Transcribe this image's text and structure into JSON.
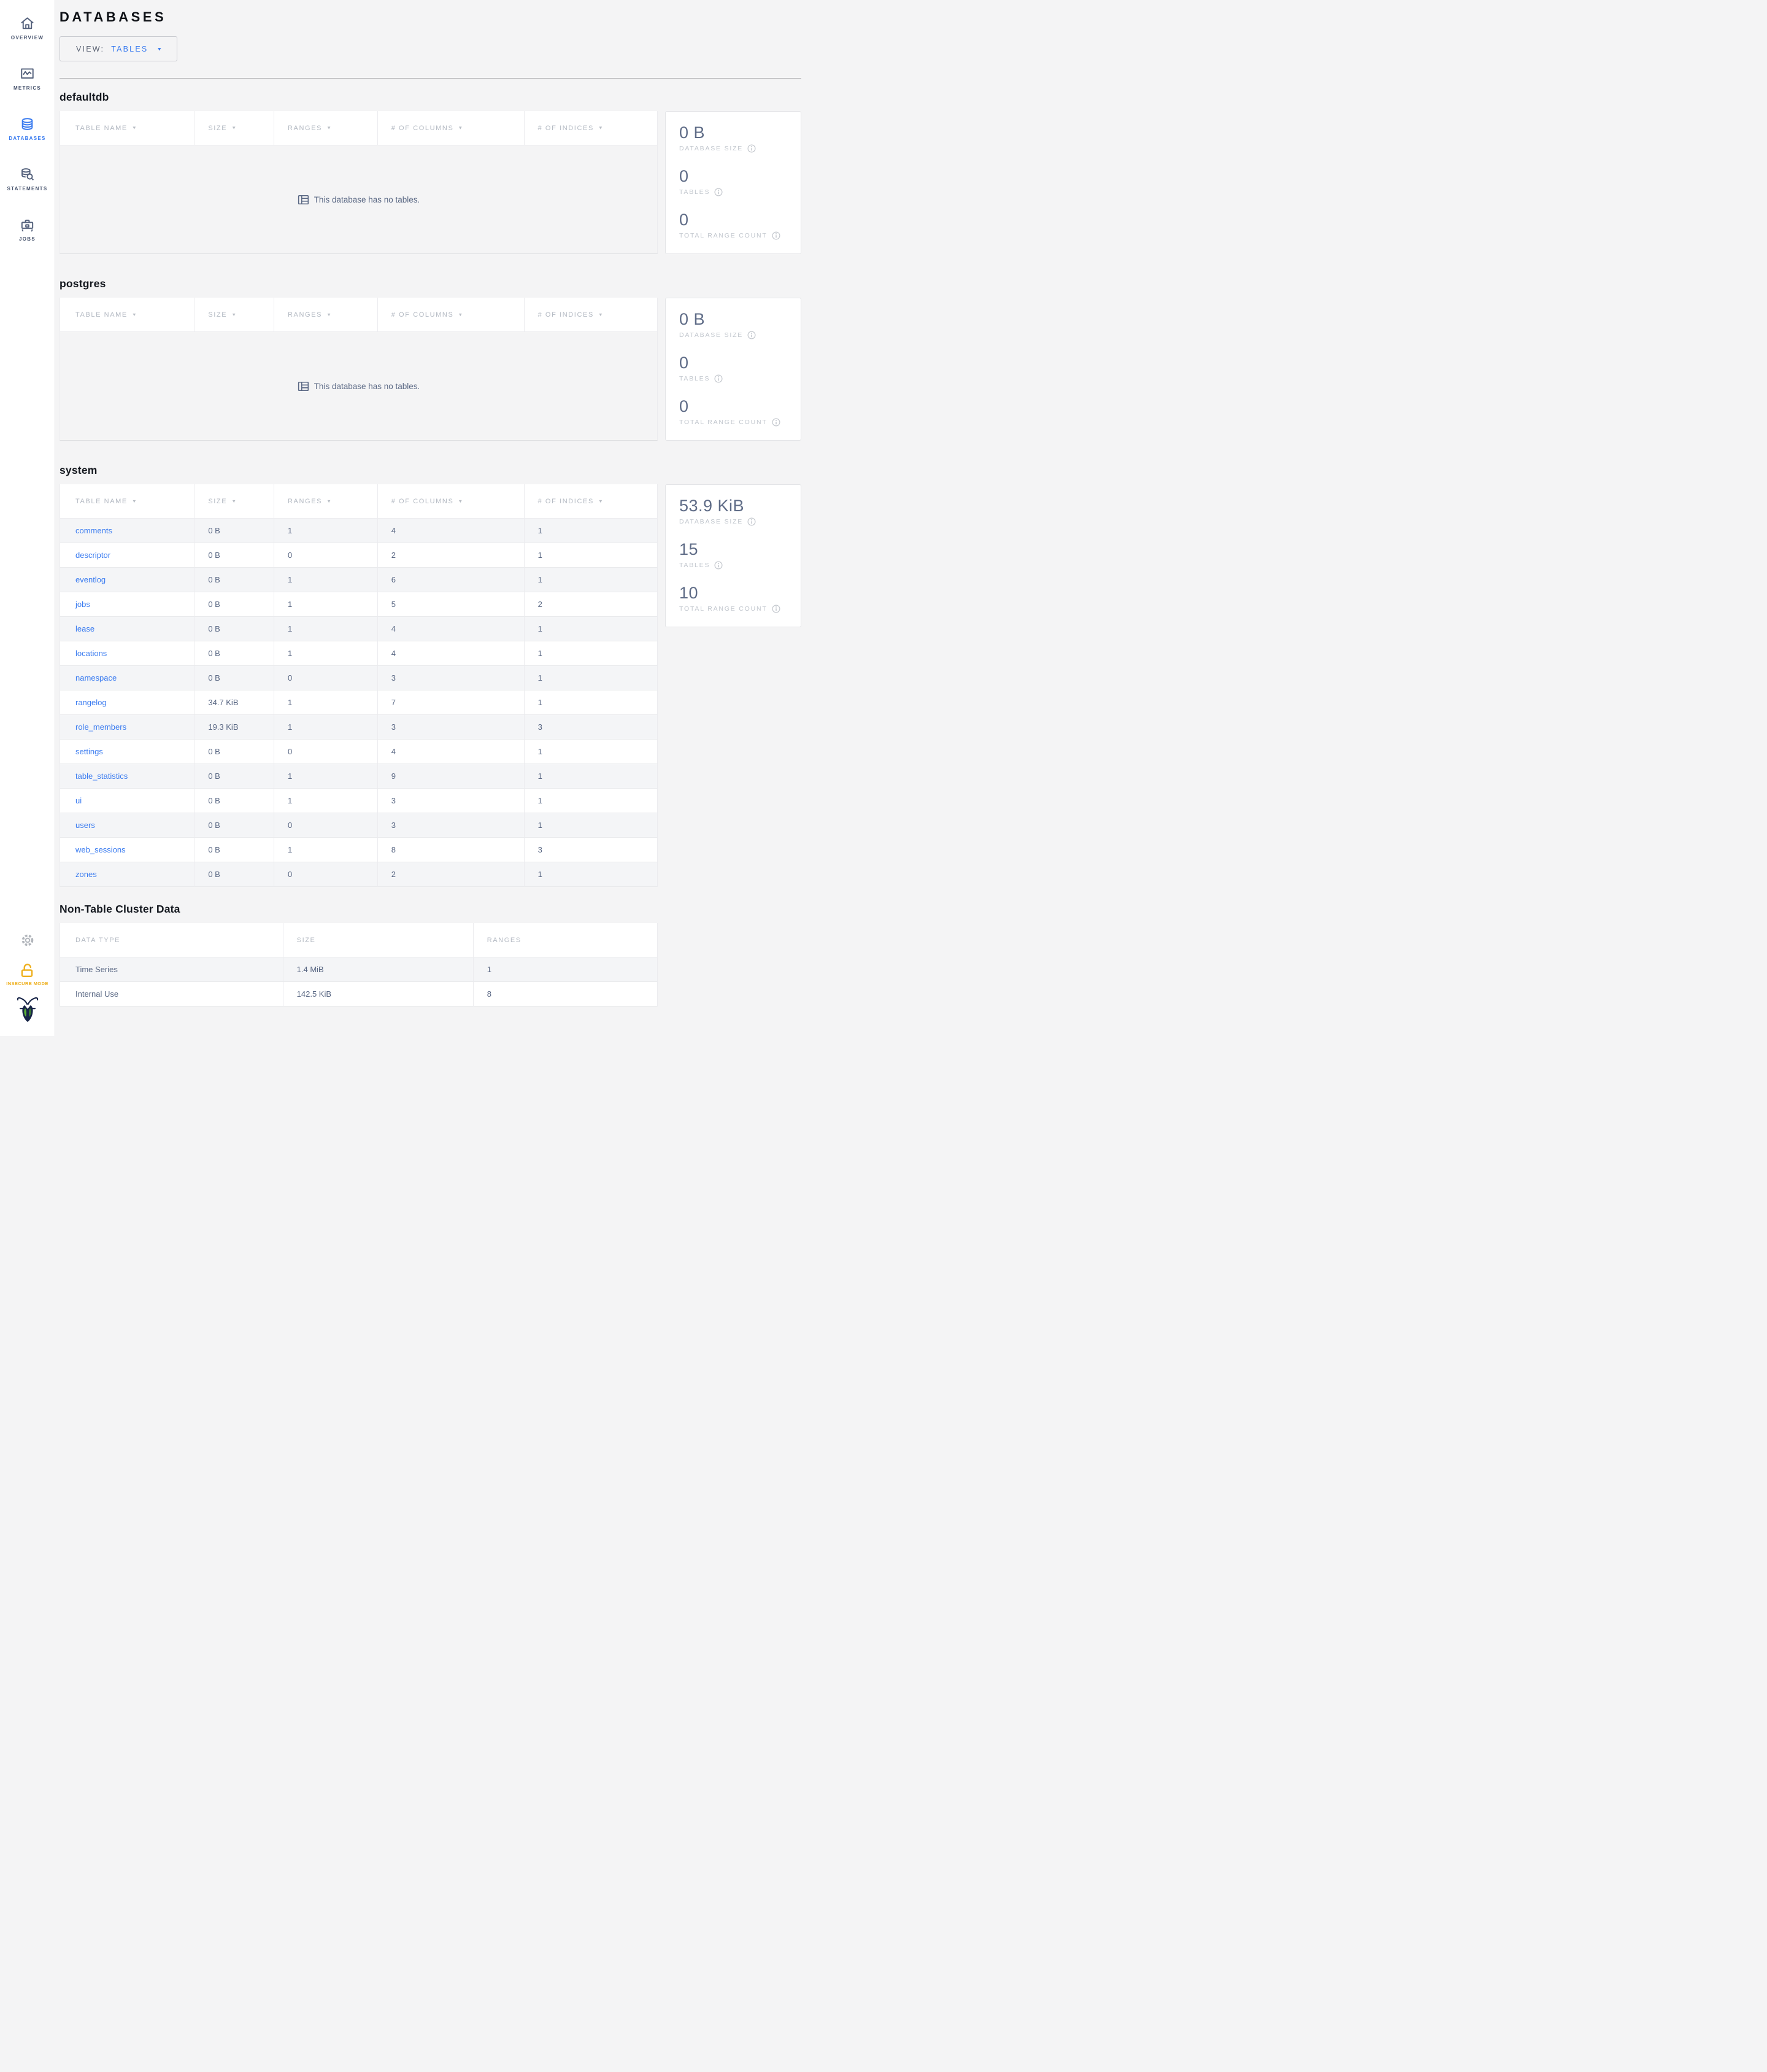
{
  "colors": {
    "accent_blue": "#3b7cf0",
    "slate": "#5f6c87",
    "warning_yellow": "#eeaf1c",
    "logo_navy": "#172447",
    "logo_green_light": "#5bb236",
    "logo_green_dark": "#3c7d32"
  },
  "sidebar": {
    "items": [
      {
        "label": "OVERVIEW",
        "icon": "home-icon",
        "active": false
      },
      {
        "label": "METRICS",
        "icon": "metrics-icon",
        "active": false
      },
      {
        "label": "DATABASES",
        "icon": "databases-icon",
        "active": true
      },
      {
        "label": "STATEMENTS",
        "icon": "statements-icon",
        "active": false
      },
      {
        "label": "JOBS",
        "icon": "jobs-icon",
        "active": false
      }
    ],
    "insecure_label": "INSECURE MODE"
  },
  "header": {
    "title": "DATABASES",
    "view_label": "VIEW:",
    "view_value": "TABLES",
    "caret": "▼"
  },
  "table_columns": [
    "TABLE NAME",
    "SIZE",
    "RANGES",
    "# OF COLUMNS",
    "# OF INDICES"
  ],
  "sort_arrow": "▼",
  "empty_message": "This database has no tables.",
  "stat_labels": {
    "size": "DATABASE SIZE",
    "tables": "TABLES",
    "ranges": "TOTAL RANGE COUNT"
  },
  "databases": [
    {
      "name": "defaultdb",
      "empty": true,
      "stats": {
        "size": "0 B",
        "tables": "0",
        "ranges": "0"
      }
    },
    {
      "name": "postgres",
      "empty": true,
      "stats": {
        "size": "0 B",
        "tables": "0",
        "ranges": "0"
      }
    },
    {
      "name": "system",
      "empty": false,
      "stats": {
        "size": "53.9 KiB",
        "tables": "15",
        "ranges": "10"
      },
      "rows": [
        {
          "name": "comments",
          "size": "0 B",
          "ranges": "1",
          "columns": "4",
          "indices": "1"
        },
        {
          "name": "descriptor",
          "size": "0 B",
          "ranges": "0",
          "columns": "2",
          "indices": "1"
        },
        {
          "name": "eventlog",
          "size": "0 B",
          "ranges": "1",
          "columns": "6",
          "indices": "1"
        },
        {
          "name": "jobs",
          "size": "0 B",
          "ranges": "1",
          "columns": "5",
          "indices": "2"
        },
        {
          "name": "lease",
          "size": "0 B",
          "ranges": "1",
          "columns": "4",
          "indices": "1"
        },
        {
          "name": "locations",
          "size": "0 B",
          "ranges": "1",
          "columns": "4",
          "indices": "1"
        },
        {
          "name": "namespace",
          "size": "0 B",
          "ranges": "0",
          "columns": "3",
          "indices": "1"
        },
        {
          "name": "rangelog",
          "size": "34.7 KiB",
          "ranges": "1",
          "columns": "7",
          "indices": "1"
        },
        {
          "name": "role_members",
          "size": "19.3 KiB",
          "ranges": "1",
          "columns": "3",
          "indices": "3"
        },
        {
          "name": "settings",
          "size": "0 B",
          "ranges": "0",
          "columns": "4",
          "indices": "1"
        },
        {
          "name": "table_statistics",
          "size": "0 B",
          "ranges": "1",
          "columns": "9",
          "indices": "1"
        },
        {
          "name": "ui",
          "size": "0 B",
          "ranges": "1",
          "columns": "3",
          "indices": "1"
        },
        {
          "name": "users",
          "size": "0 B",
          "ranges": "0",
          "columns": "3",
          "indices": "1"
        },
        {
          "name": "web_sessions",
          "size": "0 B",
          "ranges": "1",
          "columns": "8",
          "indices": "3"
        },
        {
          "name": "zones",
          "size": "0 B",
          "ranges": "0",
          "columns": "2",
          "indices": "1"
        }
      ]
    }
  ],
  "non_table": {
    "title": "Non-Table Cluster Data",
    "columns": [
      "DATA TYPE",
      "SIZE",
      "RANGES"
    ],
    "rows": [
      {
        "type": "Time Series",
        "size": "1.4 MiB",
        "ranges": "1"
      },
      {
        "type": "Internal Use",
        "size": "142.5 KiB",
        "ranges": "8"
      }
    ]
  }
}
